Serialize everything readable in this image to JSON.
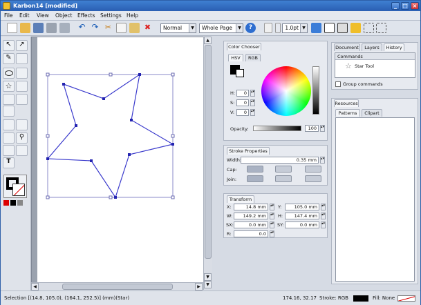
{
  "window": {
    "title": "Karbon14 [modified]"
  },
  "menu": [
    "File",
    "Edit",
    "View",
    "Object",
    "Effects",
    "Settings",
    "Help"
  ],
  "toolbar": {
    "view_mode": "Normal",
    "zoom": "Whole Page",
    "stroke_width": "1.0pt"
  },
  "color_chooser": {
    "title": "Color Chooser",
    "tabs": [
      "HSV",
      "RGB"
    ],
    "h_label": "H:",
    "h_value": "0",
    "s_label": "S:",
    "s_value": "0",
    "v_label": "V:",
    "v_value": "0",
    "opacity_label": "Opacity:",
    "opacity_value": "100"
  },
  "stroke": {
    "title": "Stroke Properties",
    "width_label": "Width:",
    "width_value": "0.35 mm",
    "cap_label": "Cap:",
    "join_label": "Join:"
  },
  "transform": {
    "title": "Transform",
    "x_label": "X:",
    "x_value": "14.8 mm",
    "y_label": "Y:",
    "y_value": "105.0 mm",
    "w_label": "W:",
    "w_value": "149.2 mm",
    "h_label": "H:",
    "h_value": "147.4 mm",
    "sx_label": "SX:",
    "sx_value": "0.0 mm",
    "sy_label": "SY:",
    "sy_value": "0.0 mm",
    "r_label": "R:",
    "r_value": "0.0"
  },
  "docker": {
    "tabs": [
      "Document",
      "Layers",
      "History"
    ],
    "commands_header": "Commands",
    "command_item": "Star Tool",
    "group_commands": "Group commands"
  },
  "resources": {
    "title": "Resources",
    "tabs": [
      "Patterns",
      "Clipart"
    ]
  },
  "status": {
    "selection": "Selection [(14.8, 105.0), (164.1, 252.5)] (mm)(Star)",
    "coords": "174.16, 32.17",
    "stroke_label": "Stroke: RGB",
    "fill_label": "Fill: None"
  },
  "colors": {
    "accent": "#2a5fb3",
    "star": "#3a3acc"
  }
}
